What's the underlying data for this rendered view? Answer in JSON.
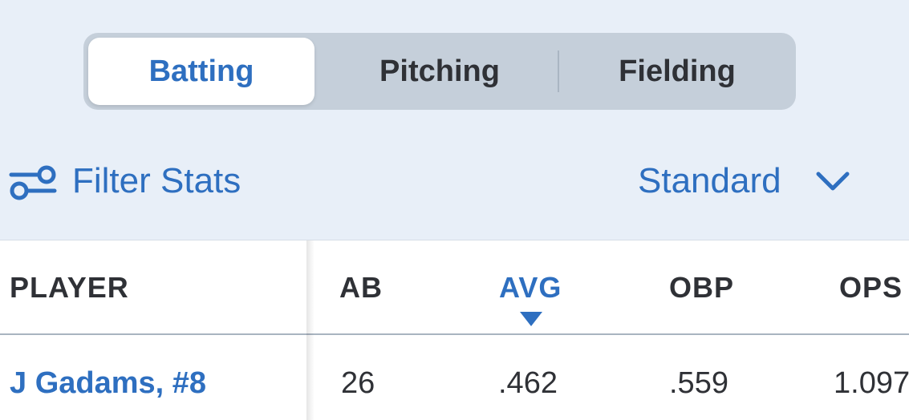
{
  "tabs": [
    {
      "label": "Batting",
      "active": true
    },
    {
      "label": "Pitching",
      "active": false
    },
    {
      "label": "Fielding",
      "active": false
    }
  ],
  "filter": {
    "label": "Filter Stats",
    "icon": "sliders-icon"
  },
  "view_select": {
    "selected": "Standard",
    "icon": "chevron-down-icon"
  },
  "table": {
    "columns": [
      "PLAYER",
      "AB",
      "AVG",
      "OBP",
      "OPS"
    ],
    "sorted_column": "AVG",
    "sort_direction": "descending",
    "rows": [
      {
        "player": "J Gadams, #8",
        "ab": "26",
        "avg": ".462",
        "obp": ".559",
        "ops": "1.097"
      }
    ]
  },
  "colors": {
    "accent": "#2e6fc0",
    "top_background": "#e8eff8",
    "segment_track": "#c5cfda",
    "text": "#2f3136"
  }
}
